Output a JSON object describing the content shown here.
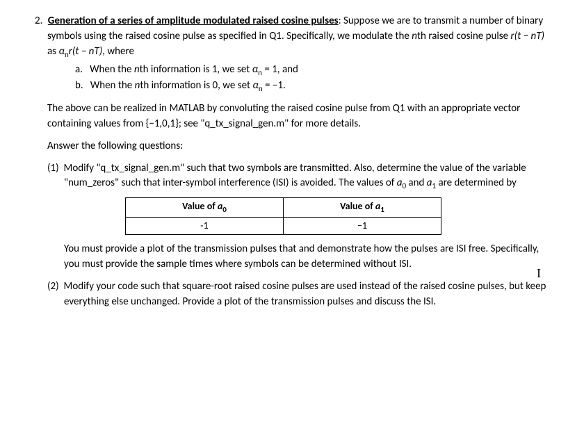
{
  "question": {
    "number": "2.",
    "title": "Generation of a series of amplitude modulated raised cosine pulses",
    "intro_after_title": ": Suppose we are to transmit a number of binary symbols using the raised cosine pulse as specified in Q1. Specifically, we modulate the ",
    "intro_nth1": "n",
    "intro_mid1": "th raised cosine pulse ",
    "intro_expr1": "r(t − nT)",
    "intro_mid2": " as ",
    "intro_expr2_a": "α",
    "intro_expr2_n": "n",
    "intro_expr2_b": "r(t − nT)",
    "intro_tail": ", where",
    "sub_a_label": "a.",
    "sub_a_p1": "When the ",
    "sub_a_nth": "n",
    "sub_a_p2": "th information is 1, we set ",
    "sub_a_alpha": "α",
    "sub_a_sub": "n",
    "sub_a_p3": " = 1, and",
    "sub_b_label": "b.",
    "sub_b_p1": "When the ",
    "sub_b_nth": "n",
    "sub_b_p2": "th information is 0, we set ",
    "sub_b_alpha": "α",
    "sub_b_sub": "n",
    "sub_b_p3": " = −1.",
    "matlab_p1": "The above can be realized in MATLAB by convoluting the raised cosine pulse from Q1 with an appropriate vector containing values from {−1,0,1}; see \"q_tx_signal_gen.m\" for more details.",
    "answer_prompt": "Answer the following questions:",
    "q1_label": "(1)",
    "q1_p1": "Modify \"q_tx_signal_gen.m\" such that two symbols are transmitted. Also, determine the value of the variable \"num_zeros\" such that inter-symbol interference (ISI) is avoided. The values of ",
    "q1_a0_a": "a",
    "q1_a0_s": "0",
    "q1_mid": " and ",
    "q1_a1_a": "a",
    "q1_a1_s": "1",
    "q1_tail": " are determined by",
    "table": {
      "h1_pre": "Value of ",
      "h1_a": "a",
      "h1_s": "0",
      "h2_pre": "Value of ",
      "h2_a": "a",
      "h2_s": "1",
      "v1": "-1",
      "v2": "−1"
    },
    "q1_after_table": "You must provide a plot of the transmission pulses that and demonstrate how the pulses are ISI free. Specifically, you must provide the sample times where symbols can be determined without ISI.",
    "q2_label": "(2)",
    "q2_body": "Modify your code such that square-root raised cosine pulses are used instead of the raised cosine pulses, but keep everything else unchanged. Provide a plot of the transmission pulses and discuss the ISI."
  },
  "cursor_glyph": "I"
}
